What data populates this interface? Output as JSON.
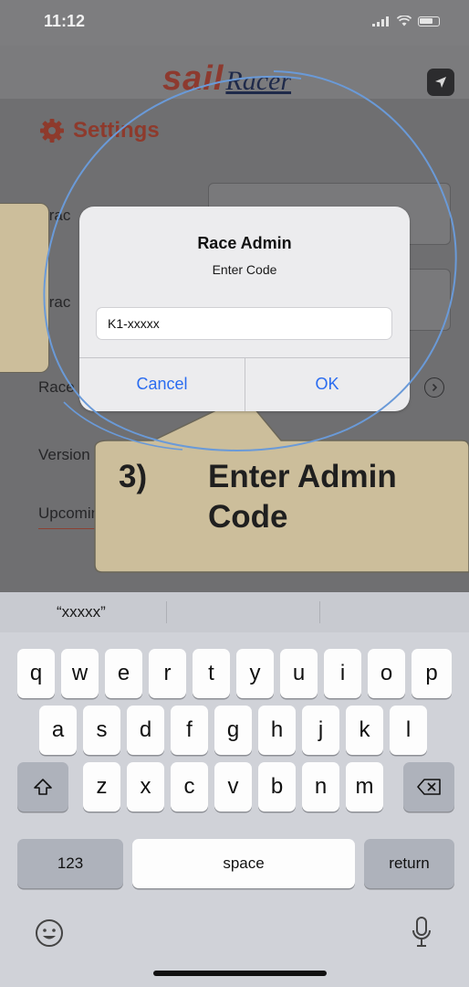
{
  "status_bar": {
    "time": "11:12"
  },
  "header": {
    "logo_sail": "sail",
    "logo_racer": "Racer"
  },
  "settings": {
    "title": "Settings",
    "rows": [
      {
        "label": "Trac"
      },
      {
        "label": "Trac"
      },
      {
        "label": "Race"
      },
      {
        "label": "Version 1.0(2.1.5)"
      },
      {
        "label": "Upcoming Races"
      }
    ]
  },
  "dialog": {
    "title": "Race Admin",
    "message": "Enter Code",
    "input_value": "K1-xxxxx",
    "cancel_label": "Cancel",
    "ok_label": "OK"
  },
  "callout": {
    "step_number": "3)",
    "line1": "Enter Admin",
    "line2": "Code"
  },
  "keyboard": {
    "suggestion": "“xxxxx”",
    "row1": [
      "q",
      "w",
      "e",
      "r",
      "t",
      "y",
      "u",
      "i",
      "o",
      "p"
    ],
    "row2": [
      "a",
      "s",
      "d",
      "f",
      "g",
      "h",
      "j",
      "k",
      "l"
    ],
    "row3": [
      "z",
      "x",
      "c",
      "v",
      "b",
      "n",
      "m"
    ],
    "numbers_label": "123",
    "space_label": "space",
    "return_label": "return"
  },
  "colors": {
    "accent": "#8e3a2c",
    "dialog_button": "#2a6cf0",
    "callout": "#ccbe9b"
  }
}
